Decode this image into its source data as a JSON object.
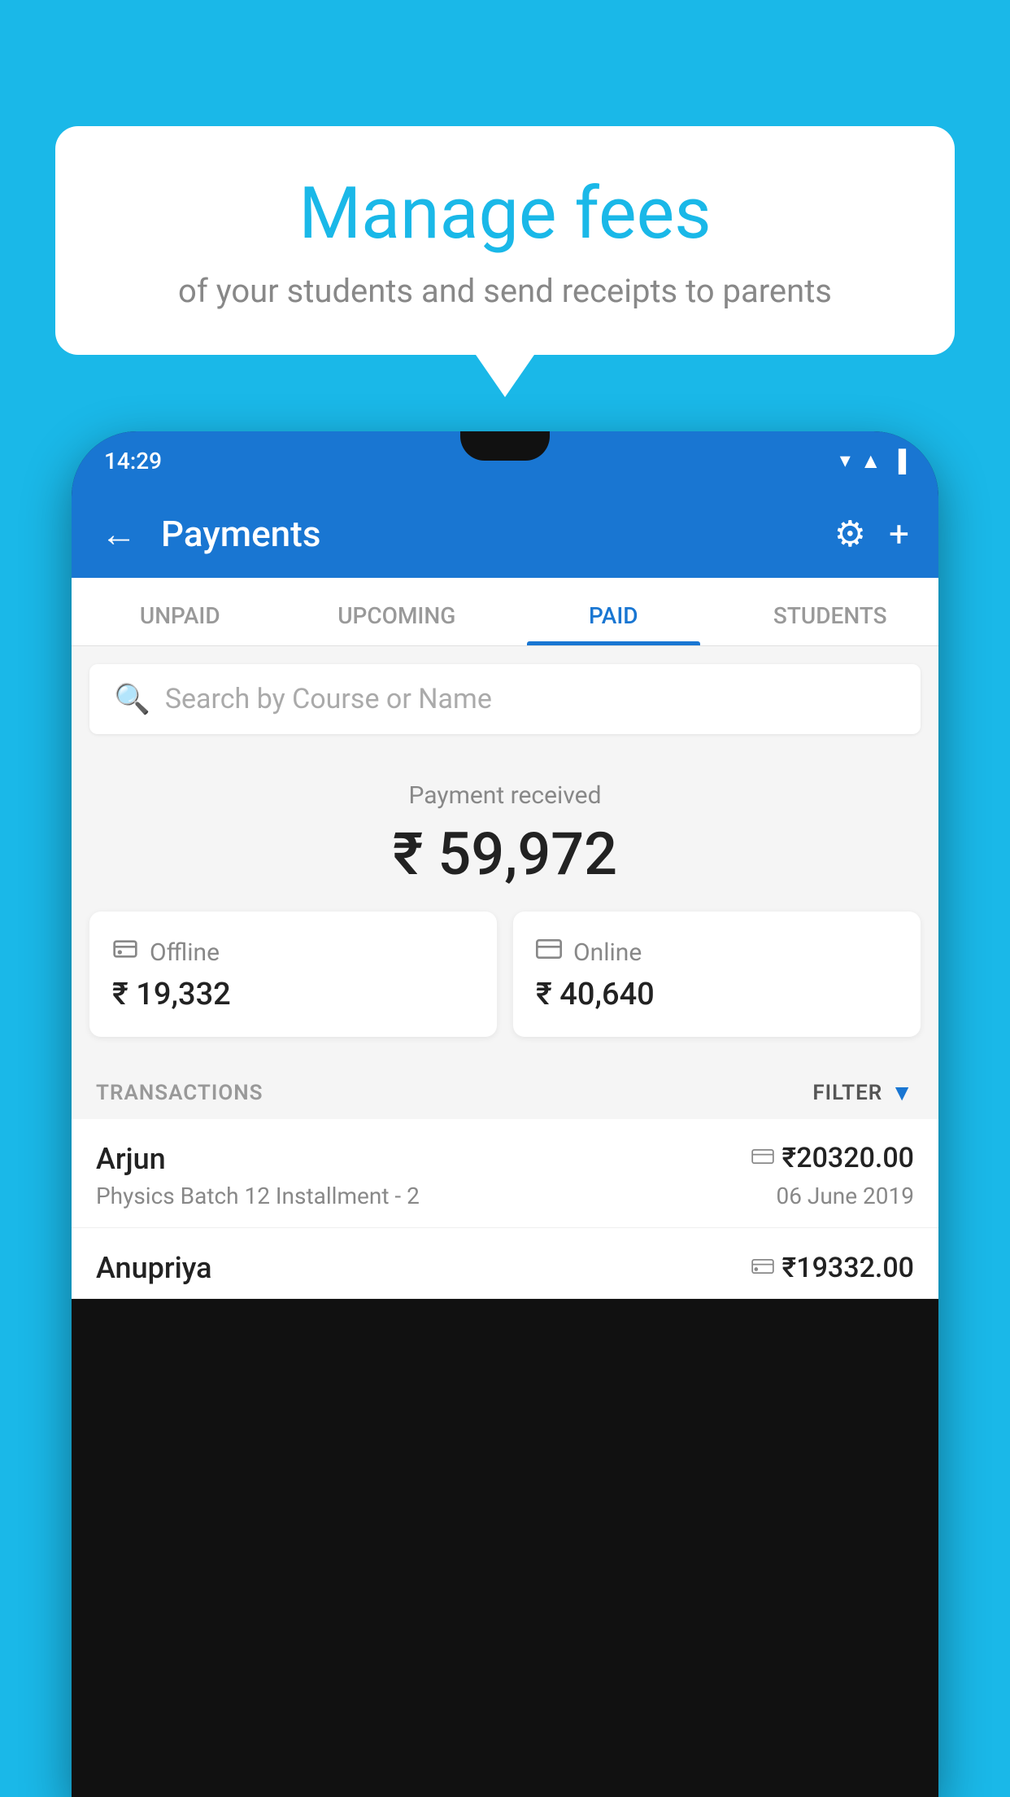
{
  "background_color": "#1ab8e8",
  "bubble": {
    "title": "Manage fees",
    "subtitle": "of your students and send receipts to parents"
  },
  "phone": {
    "status_bar": {
      "time": "14:29",
      "icons": "▼◄▐"
    },
    "header": {
      "title": "Payments",
      "back_label": "←",
      "settings_label": "⚙",
      "add_label": "+"
    },
    "tabs": [
      {
        "label": "UNPAID",
        "active": false
      },
      {
        "label": "UPCOMING",
        "active": false
      },
      {
        "label": "PAID",
        "active": true
      },
      {
        "label": "STUDENTS",
        "active": false
      }
    ],
    "search": {
      "placeholder": "Search by Course or Name"
    },
    "payment_summary": {
      "label": "Payment received",
      "amount": "₹ 59,972"
    },
    "cards": [
      {
        "type": "Offline",
        "icon": "offline",
        "amount": "₹ 19,332"
      },
      {
        "type": "Online",
        "icon": "online",
        "amount": "₹ 40,640"
      }
    ],
    "transactions_label": "TRANSACTIONS",
    "filter_label": "FILTER",
    "transactions": [
      {
        "name": "Arjun",
        "detail": "Physics Batch 12 Installment - 2",
        "amount": "₹20320.00",
        "date": "06 June 2019",
        "payment_type": "card"
      },
      {
        "name": "Anupriya",
        "detail": "",
        "amount": "₹19332.00",
        "date": "",
        "payment_type": "offline"
      }
    ]
  }
}
